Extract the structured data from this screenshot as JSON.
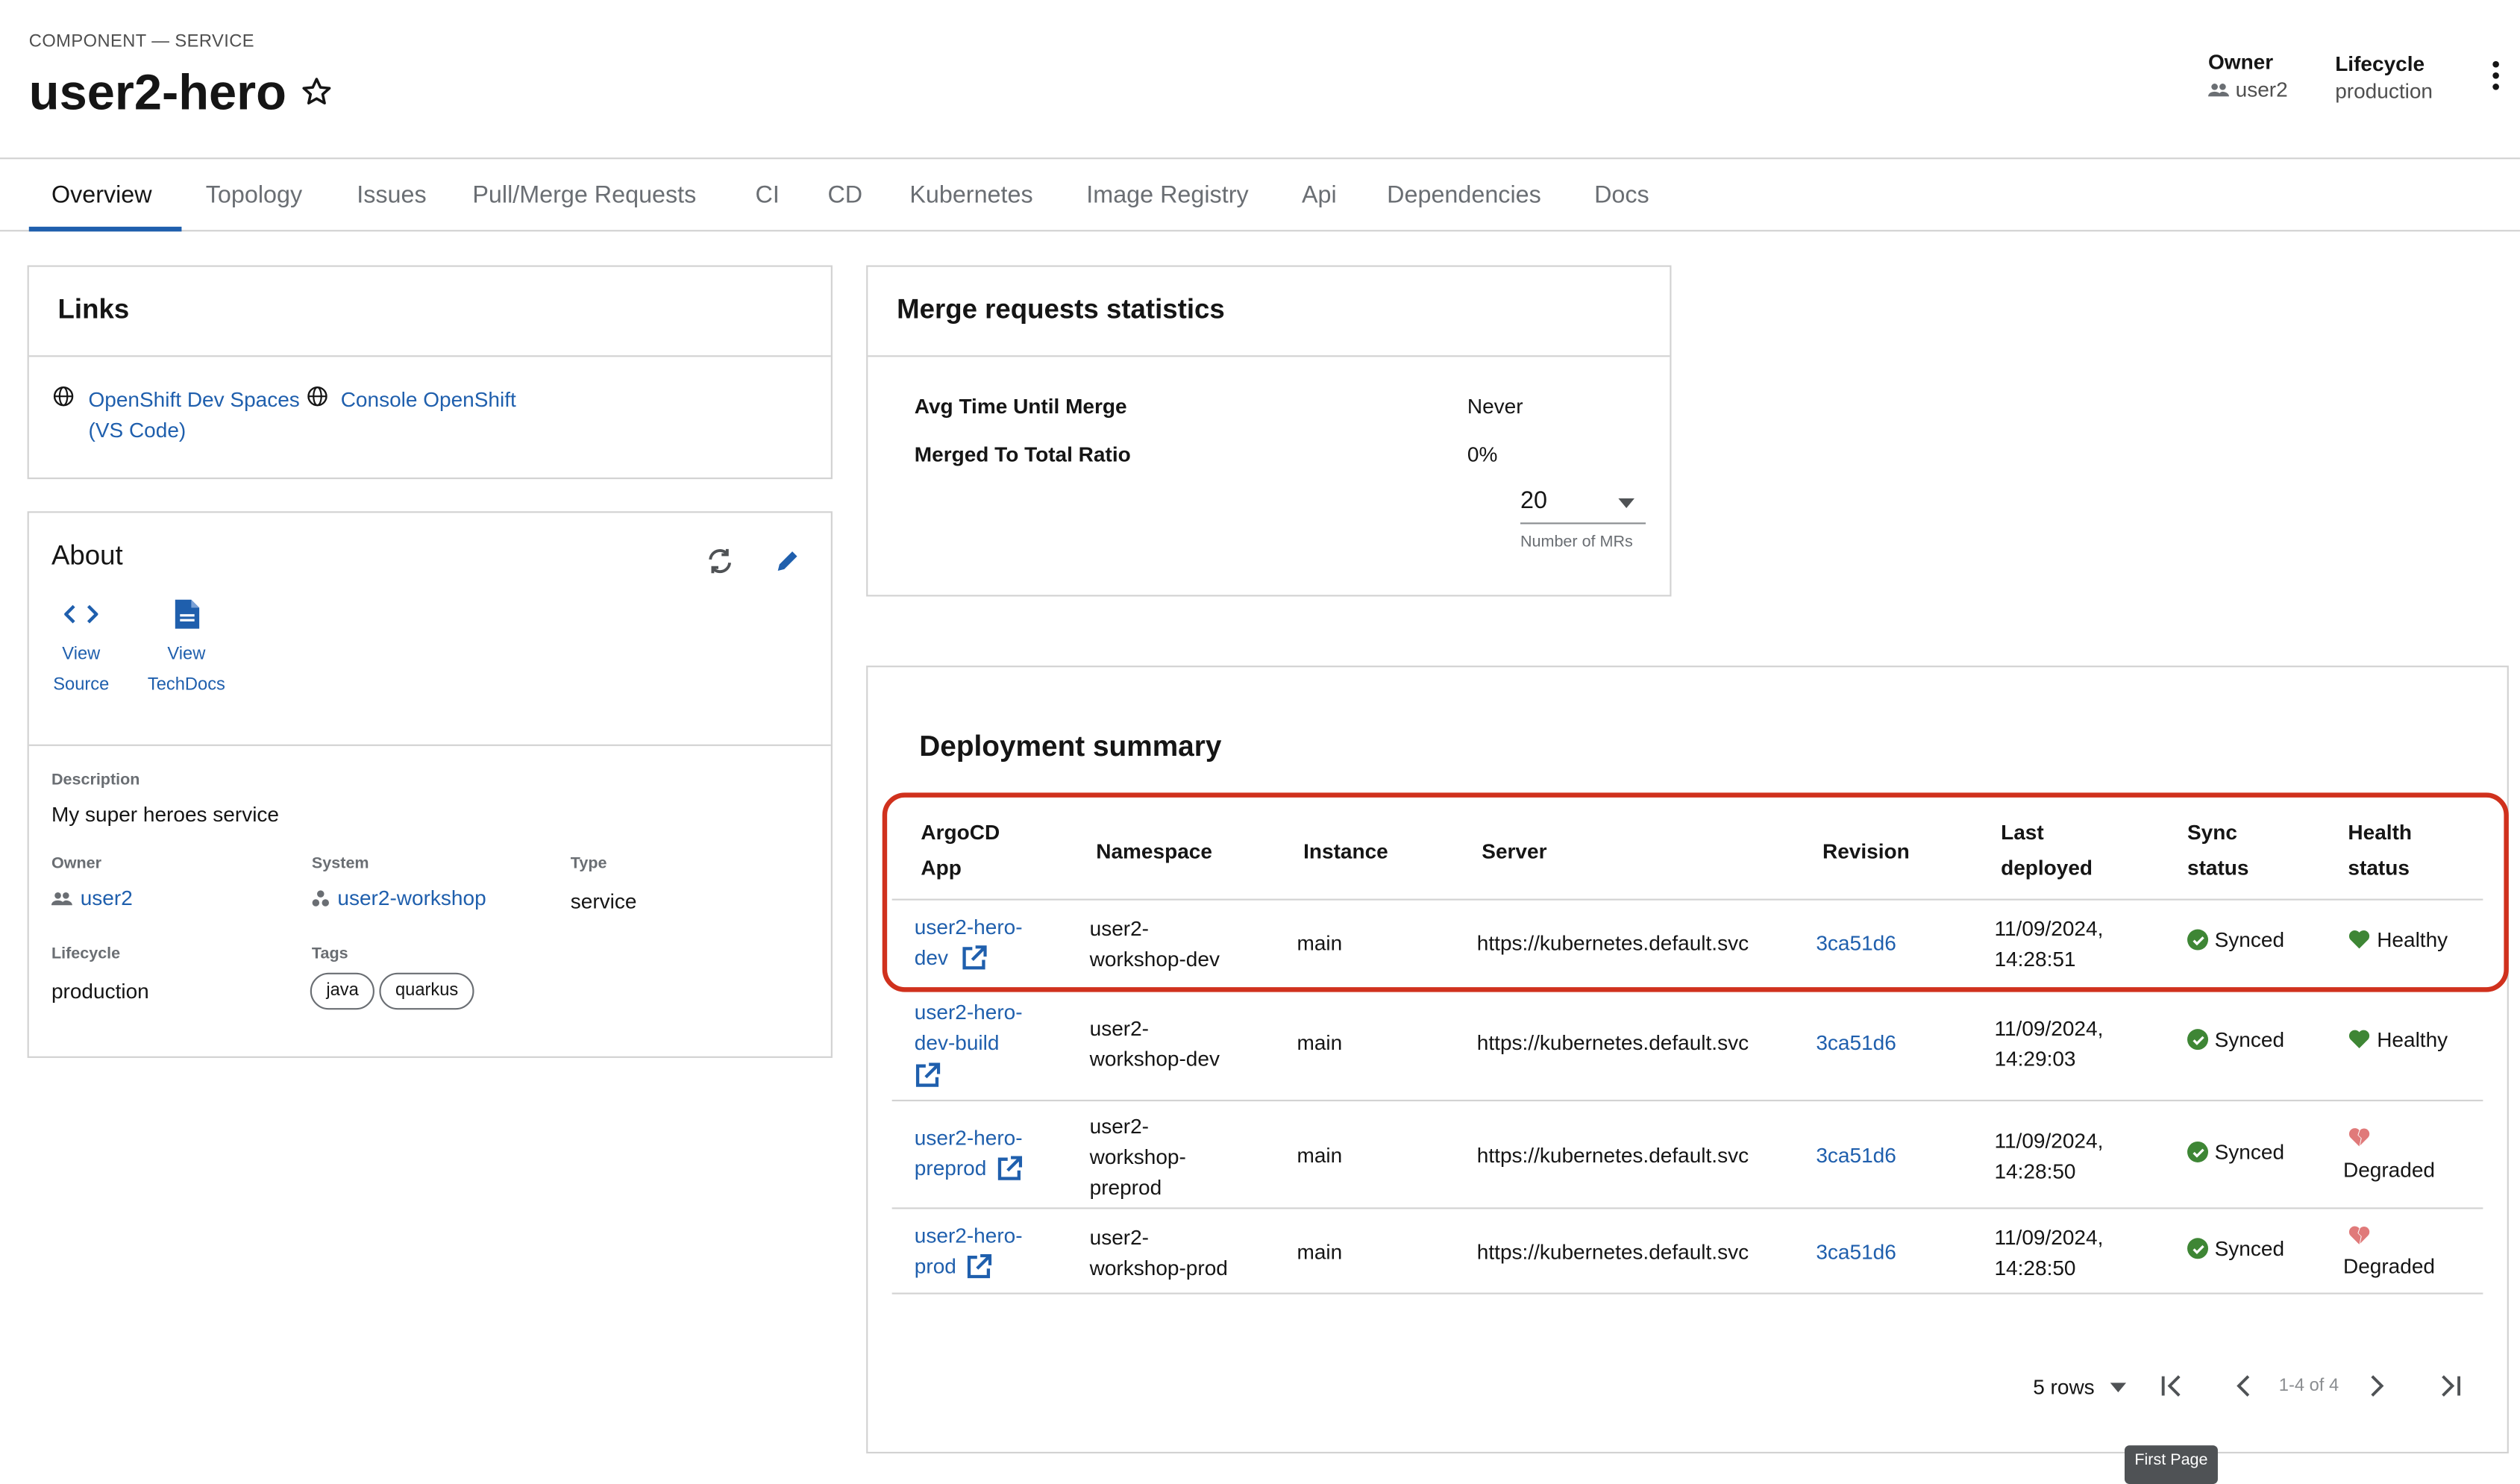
{
  "header": {
    "kind": "COMPONENT — SERVICE",
    "title": "user2-hero",
    "owner_label": "Owner",
    "owner_value": "user2",
    "lifecycle_label": "Lifecycle",
    "lifecycle_value": "production"
  },
  "tabs": [
    "Overview",
    "Topology",
    "Issues",
    "Pull/Merge Requests",
    "CI",
    "CD",
    "Kubernetes",
    "Image Registry",
    "Api",
    "Dependencies",
    "Docs"
  ],
  "links": {
    "title": "Links",
    "items": [
      {
        "line1": "OpenShift Dev Spaces",
        "line2": "(VS Code)"
      },
      {
        "line1": "Console OpenShift"
      }
    ]
  },
  "about": {
    "title": "About",
    "view_source": [
      "View",
      "Source"
    ],
    "view_techdocs": [
      "View",
      "TechDocs"
    ],
    "description_label": "Description",
    "description": "My super heroes service",
    "owner_label": "Owner",
    "owner": "user2",
    "system_label": "System",
    "system": "user2-workshop",
    "type_label": "Type",
    "type": "service",
    "lifecycle_label": "Lifecycle",
    "lifecycle": "production",
    "tags_label": "Tags",
    "tags": [
      "java",
      "quarkus"
    ]
  },
  "merge_stats": {
    "title": "Merge requests statistics",
    "rows": [
      {
        "label": "Avg Time Until Merge",
        "value": "Never"
      },
      {
        "label": "Merged To Total Ratio",
        "value": "0%"
      }
    ],
    "select_value": "20",
    "select_caption": "Number of MRs"
  },
  "deployment": {
    "title": "Deployment summary",
    "headers": {
      "app": [
        "ArgoCD",
        "App"
      ],
      "namespace": "Namespace",
      "instance": "Instance",
      "server": "Server",
      "revision": "Revision",
      "last_deployed": [
        "Last",
        "deployed"
      ],
      "sync": [
        "Sync",
        "status"
      ],
      "health": [
        "Health",
        "status"
      ]
    },
    "rows": [
      {
        "app": [
          "user2-hero-",
          "dev"
        ],
        "namespace": [
          "user2-",
          "workshop-dev"
        ],
        "instance": "main",
        "server": "https://kubernetes.default.svc",
        "revision": "3ca51d6",
        "deployed": [
          "11/09/2024,",
          "14:28:51"
        ],
        "sync": "Synced",
        "health": "Healthy"
      },
      {
        "app": [
          "user2-hero-",
          "dev-build"
        ],
        "namespace": [
          "user2-",
          "workshop-dev"
        ],
        "instance": "main",
        "server": "https://kubernetes.default.svc",
        "revision": "3ca51d6",
        "deployed": [
          "11/09/2024,",
          "14:29:03"
        ],
        "sync": "Synced",
        "health": "Healthy"
      },
      {
        "app": [
          "user2-hero-",
          "preprod"
        ],
        "namespace": [
          "user2-",
          "workshop-",
          "preprod"
        ],
        "instance": "main",
        "server": "https://kubernetes.default.svc",
        "revision": "3ca51d6",
        "deployed": [
          "11/09/2024,",
          "14:28:50"
        ],
        "sync": "Synced",
        "health": "Degraded"
      },
      {
        "app": [
          "user2-hero-",
          "prod"
        ],
        "namespace": [
          "user2-",
          "workshop-prod"
        ],
        "instance": "main",
        "server": "https://kubernetes.default.svc",
        "revision": "3ca51d6",
        "deployed": [
          "11/09/2024,",
          "14:28:50"
        ],
        "sync": "Synced",
        "health": "Degraded"
      }
    ],
    "pager": {
      "rows_label": "5 rows",
      "range": "1-4 of 4",
      "tooltip": "First Page"
    }
  },
  "colors": {
    "link": "#1f5fad",
    "healthy": "#3e8635",
    "degraded": "#e07a7a",
    "highlight": "#d0311d"
  }
}
